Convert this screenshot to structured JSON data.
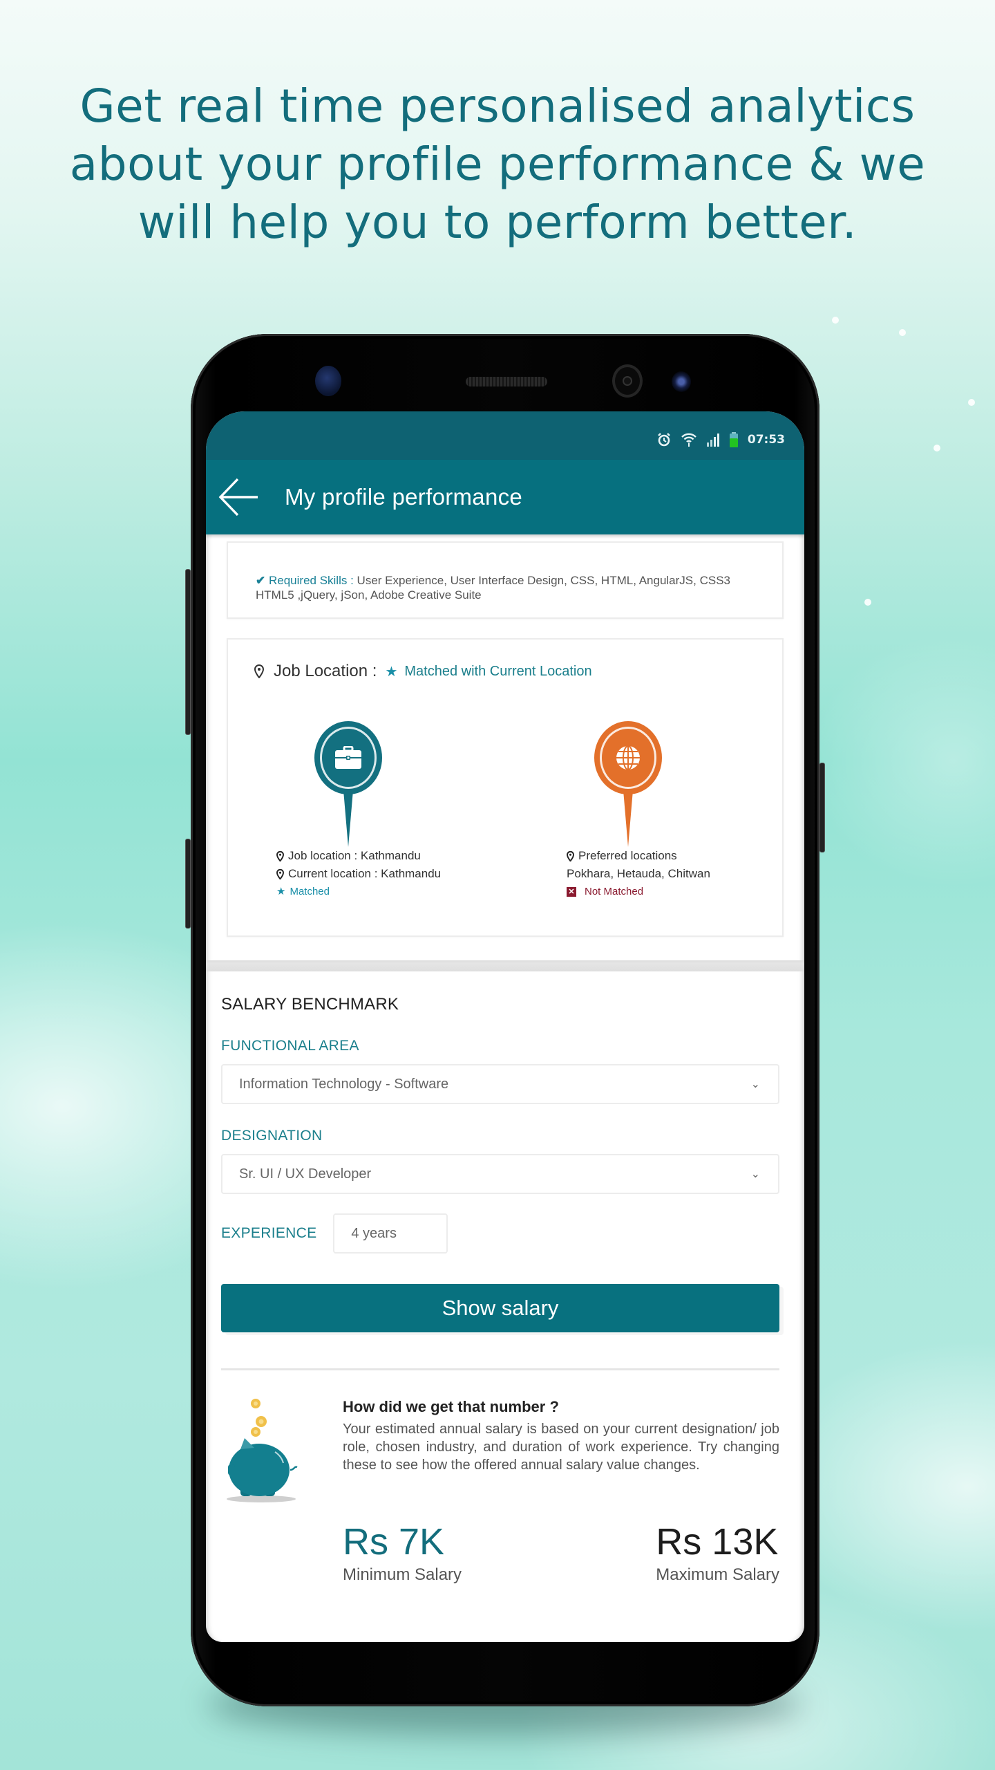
{
  "promo": {
    "headline_lines": [
      "Get real time personalised analytics",
      "about your profile performance & we",
      "will help you to perform better."
    ]
  },
  "status_bar": {
    "time": "07:53",
    "icons": [
      "alarm-icon",
      "wifi-icon",
      "signal-icon",
      "battery-icon"
    ],
    "battery_color": "#22c322"
  },
  "app_bar": {
    "back_icon": "arrow-left-icon",
    "title": "My profile performance",
    "color": "#06707f"
  },
  "skills": {
    "label": "Required Skills :",
    "line1": "User Experience,  User Interface Design,  CSS,  HTML,  AngularJS,  CSS3",
    "line2": "HTML5 ,jQuery,  jSon,  Adobe Creative Suite"
  },
  "job_location": {
    "title": "Job Location :",
    "status": "Matched with Current Location",
    "left": {
      "icon": "briefcase-icon",
      "job_location": "Job location : Kathmandu",
      "current_location": "Current location : Kathmandu",
      "result": "Matched"
    },
    "right": {
      "icon": "globe-icon",
      "heading": "Preferred locations",
      "locations": "Pokhara, Hetauda, Chitwan",
      "result": "Not Matched"
    },
    "colors": {
      "teal": "#137080",
      "orange": "#e3702a",
      "not_matched": "#8a1a2f"
    }
  },
  "salary_benchmark": {
    "title": "SALARY BENCHMARK",
    "functional_area": {
      "label": "FUNCTIONAL AREA",
      "value": "Information Technology - Software"
    },
    "designation": {
      "label": "DESIGNATION",
      "value": "Sr. UI / UX Developer"
    },
    "experience": {
      "label": "EXPERIENCE",
      "value": "4 years"
    },
    "button": "Show salary",
    "explain": {
      "title": "How did we get that number ?",
      "body": "Your estimated annual salary is based on your current designation/ job role, chosen industry, and duration of work experience. Try changing these to see how the offered annual salary value changes."
    },
    "minimum": {
      "amount": "Rs 7K",
      "label": "Minimum Salary"
    },
    "maximum": {
      "amount": "Rs 13K",
      "label": "Maximum Salary"
    }
  }
}
